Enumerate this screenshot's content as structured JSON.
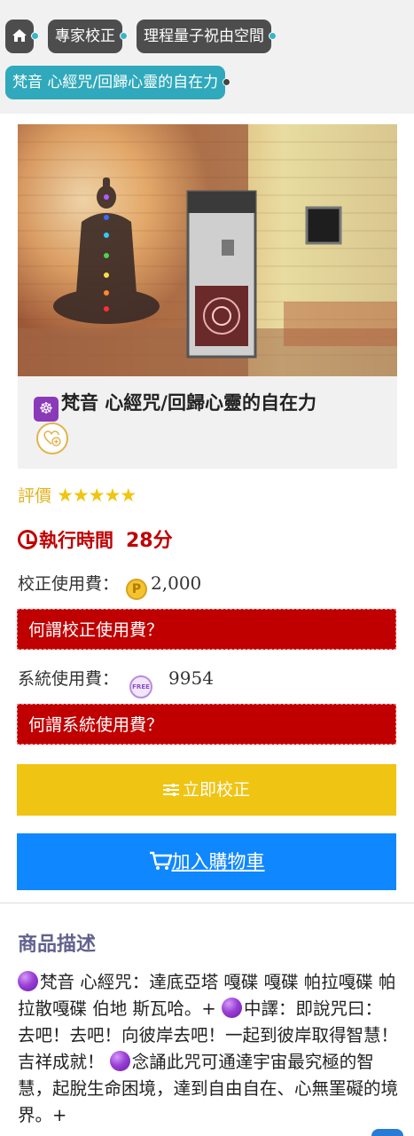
{
  "breadcrumb": {
    "home_icon": "home-icon",
    "items": [
      {
        "label": "專家校正"
      },
      {
        "label": "理程量子祝由空間"
      },
      {
        "label": "梵音 心經咒/回歸心靈的自在力"
      }
    ]
  },
  "product": {
    "title": "梵音 心經咒/回歸心靈的自在力",
    "title_icon": "☸",
    "favorite_icon": "heart-plus-icon"
  },
  "rating": {
    "label": "評價",
    "stars": "★★★★★",
    "value": 5
  },
  "time": {
    "label": "執行時間",
    "value": "28分"
  },
  "calibration_fee": {
    "label": "校正使用費：",
    "coin": "P",
    "amount": "2,000",
    "help": "何謂校正使用費？"
  },
  "system_fee": {
    "label": "系統使用費：",
    "icon_text": "FREE",
    "amount": "9954",
    "help": "何謂系統使用費？"
  },
  "buttons": {
    "calibrate": "立即校正",
    "cart": "加入購物車"
  },
  "description": {
    "heading": "商品描述",
    "segments": [
      "梵音 心經咒：達底亞塔 嘎碟 嘎碟 帕拉嘎碟 帕拉散嘎碟 伯地 斯瓦哈。+ ",
      "中譯：即說咒曰：去吧！去吧！向彼岸去吧！一起到彼岸取得智慧！吉祥成就！ ",
      "念誦此咒可通達宇宙最究極的智慧，起脫生命困境，達到自由自在、心無罣礙的境界。+"
    ]
  },
  "colors": {
    "accent_red": "#c00000",
    "accent_yellow": "#f0c412",
    "accent_blue": "#0f87ff",
    "teal": "#2fa9bb"
  }
}
